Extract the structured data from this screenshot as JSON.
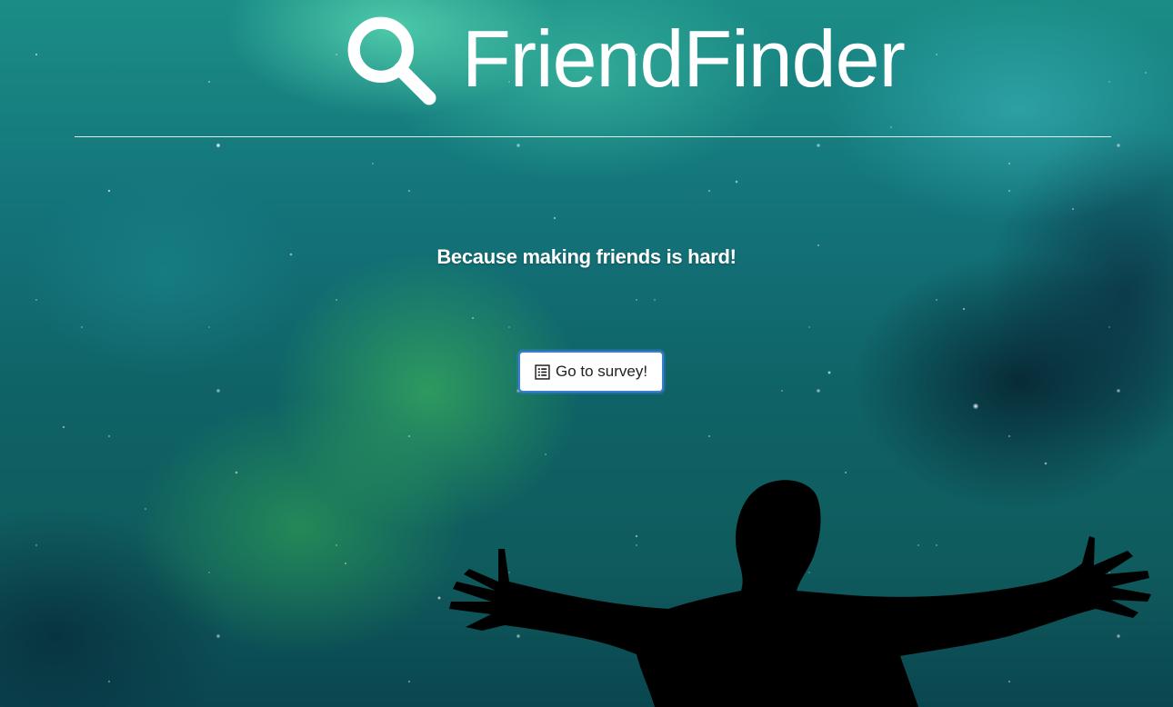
{
  "brand": {
    "title": "FriendFinder",
    "icon": "search-icon"
  },
  "hero": {
    "tagline": "Because making friends is hard!"
  },
  "survey_button": {
    "label": "Go to survey!",
    "icon": "list-alt-icon"
  },
  "theme": {
    "text_color": "#ffffff",
    "button_border": "#3b7fd1",
    "background": "galaxy-nebula"
  }
}
